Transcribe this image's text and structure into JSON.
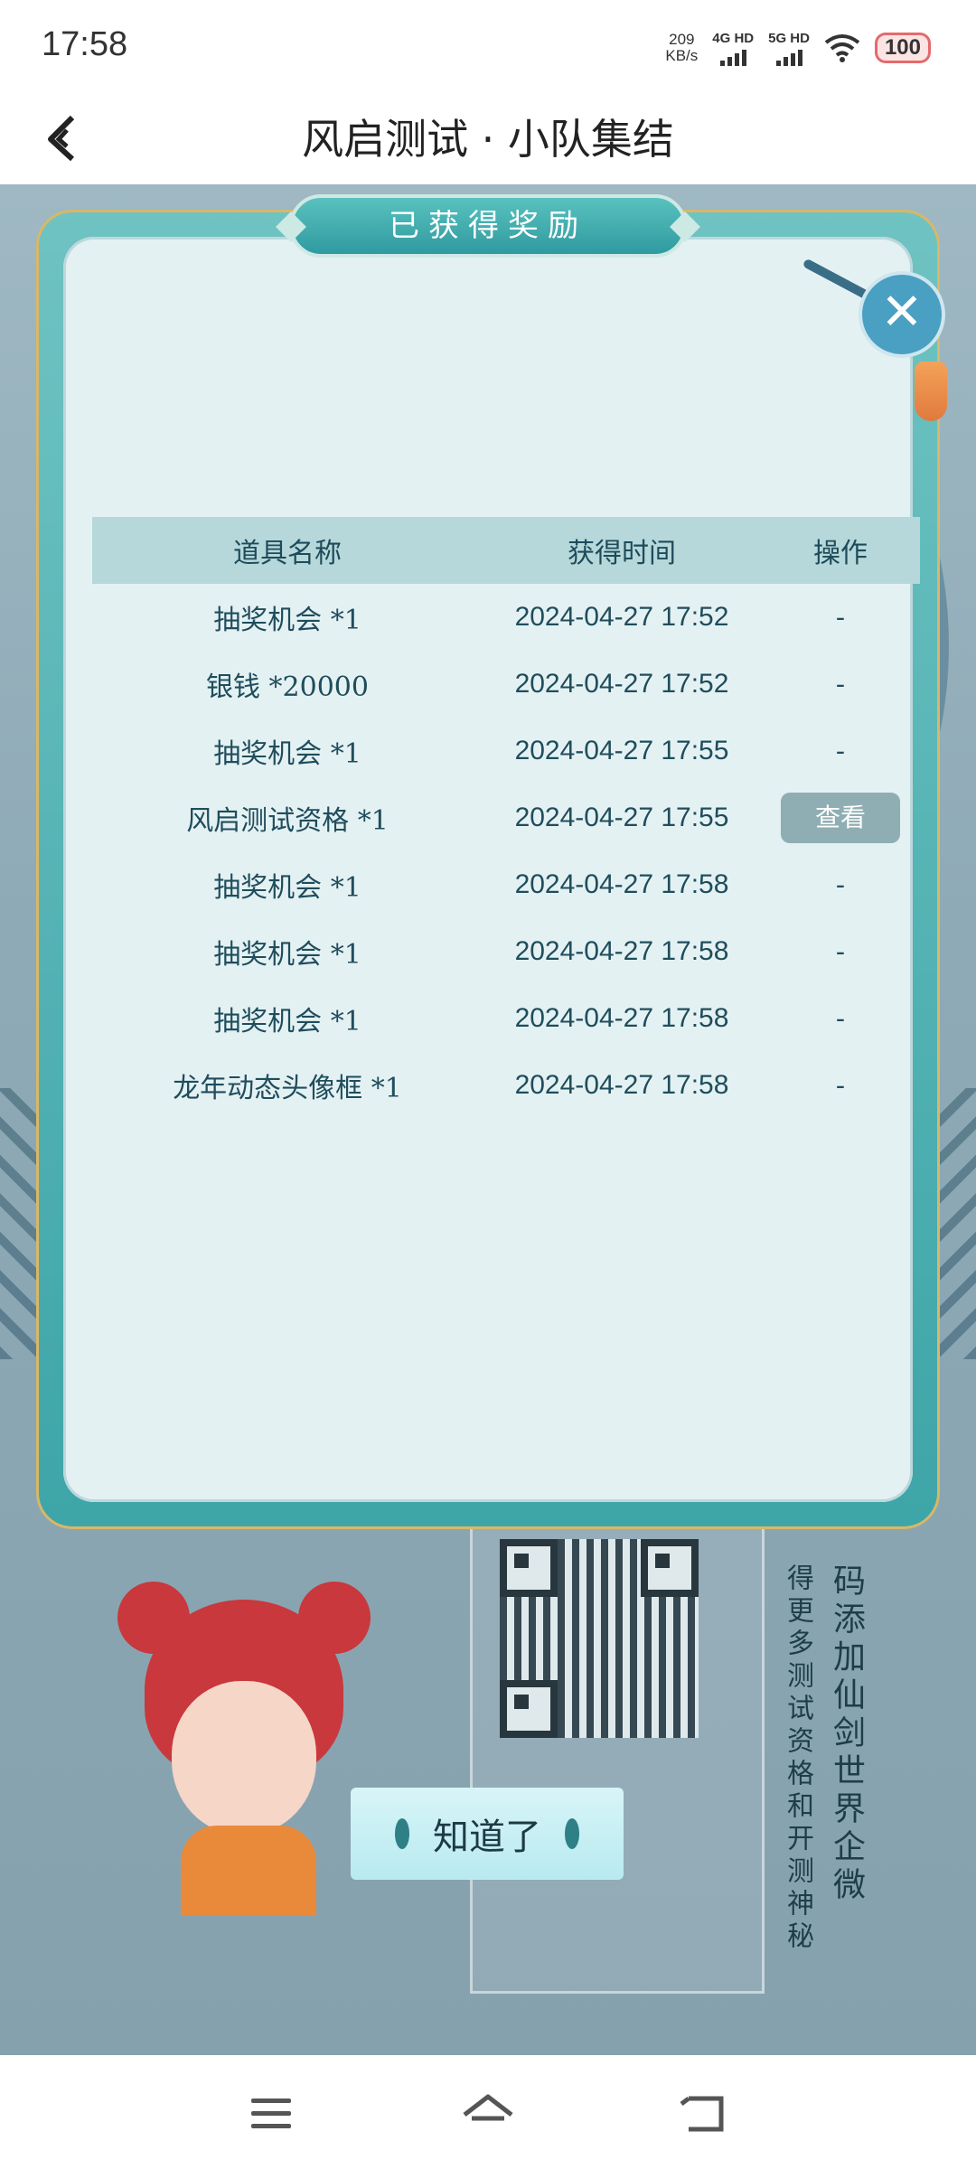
{
  "status_bar": {
    "time": "17:58",
    "net_speed_value": "209",
    "net_speed_unit": "KB/s",
    "signal1_label": "4G HD",
    "signal2_label": "5G HD",
    "battery": "100"
  },
  "header": {
    "title": "风启测试 · 小队集结"
  },
  "dialog": {
    "title": "已获得奖励",
    "columns": [
      "道具名称",
      "获得时间",
      "操作"
    ],
    "rows": [
      {
        "item": "抽奖机会 *1",
        "time": "2024-04-27  17:52",
        "action": "-"
      },
      {
        "item": "银钱 *20000",
        "time": "2024-04-27  17:52",
        "action": "-"
      },
      {
        "item": "抽奖机会 *1",
        "time": "2024-04-27  17:55",
        "action": "-"
      },
      {
        "item": "风启测试资格 *1",
        "time": "2024-04-27  17:55",
        "action": "查看"
      },
      {
        "item": "抽奖机会 *1",
        "time": "2024-04-27  17:58",
        "action": "-"
      },
      {
        "item": "抽奖机会 *1",
        "time": "2024-04-27  17:58",
        "action": "-"
      },
      {
        "item": "抽奖机会 *1",
        "time": "2024-04-27  17:58",
        "action": "-"
      },
      {
        "item": "龙年动态头像框 *1",
        "time": "2024-04-27  17:58",
        "action": "-"
      }
    ],
    "confirm_label": "知道了"
  },
  "background": {
    "qr_caption_1": "得更多测试资格和开测神秘",
    "qr_caption_2": "码添加仙剑世界企微"
  }
}
